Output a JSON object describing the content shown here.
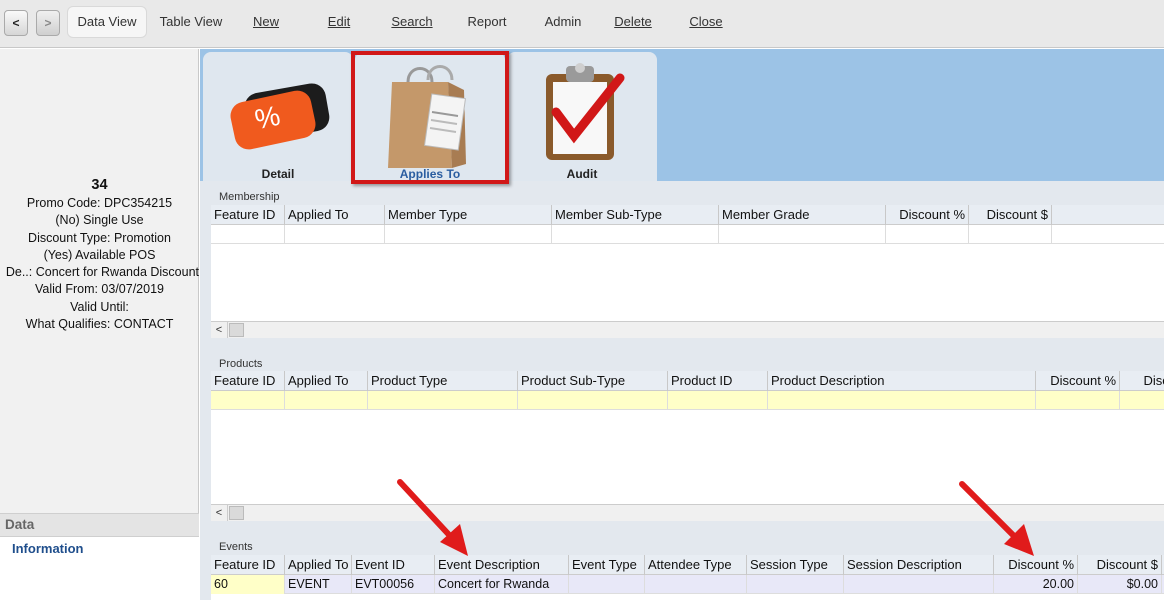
{
  "nav": {
    "back": "<",
    "forward": ">"
  },
  "toolbar": {
    "data_view": "Data View",
    "table_view": "Table View",
    "new": "New",
    "edit": "Edit",
    "search": "Search",
    "report": "Report",
    "admin": "Admin",
    "delete": "Delete",
    "close": "Close"
  },
  "summary": {
    "id": "34",
    "promo_code": "Promo Code: DPC354215",
    "single_use": "(No) Single Use",
    "discount_type": "Discount Type: Promotion",
    "available_pos": "(Yes) Available POS",
    "description": "De..: Concert for Rwanda Discount",
    "valid_from": "Valid From: 03/07/2019",
    "valid_until": "Valid Until:",
    "what_qualifies": "What Qualifies: CONTACT"
  },
  "data_panel": {
    "header": "Data",
    "information": "Information"
  },
  "tabs": {
    "detail": "Detail",
    "applies_to": "Applies To",
    "audit": "Audit"
  },
  "membership": {
    "label": "Membership",
    "columns": [
      "Feature ID",
      "Applied To",
      "Member Type",
      "Member Sub-Type",
      "Member Grade",
      "Discount %",
      "Discount $"
    ]
  },
  "products": {
    "label": "Products",
    "columns": [
      "Feature ID",
      "Applied To",
      "Product Type",
      "Product Sub-Type",
      "Product ID",
      "Product Description",
      "Discount %",
      "Disco"
    ]
  },
  "events": {
    "label": "Events",
    "columns": [
      "Feature ID",
      "Applied To",
      "Event ID",
      "Event Description",
      "Event Type",
      "Attendee Type",
      "Session Type",
      "Session Description",
      "Discount %",
      "Discount $"
    ],
    "rows": [
      {
        "feature_id": "60",
        "applied_to": "EVENT",
        "event_id": "EVT00056",
        "event_description": "Concert for Rwanda",
        "event_type": "",
        "attendee_type": "",
        "session_type": "",
        "session_description": "",
        "discount_pct": "20.00",
        "discount_amt": "$0.00"
      }
    ]
  },
  "scroll_left": "<",
  "colors": {
    "tab_strip": "#9cc3e6",
    "highlight": "#d11818",
    "selected_row": "#ffffc8",
    "event_row": "#e8e8f8"
  }
}
